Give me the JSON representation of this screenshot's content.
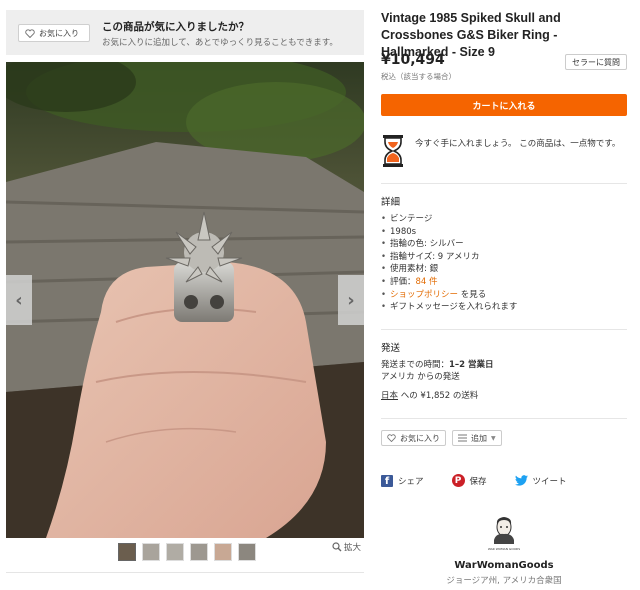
{
  "favorite_banner": {
    "button_label": "お気に入り",
    "heading": "この商品が気に入りましたか？",
    "subtext": "お気に入りに追加して、あとでゆっくり見ることもできます。"
  },
  "listing": {
    "title": "Vintage 1985 Spiked Skull and Crossbones G&S Biker Ring - Hallmarked - Size 9",
    "price": "¥10,494",
    "tax_note": "税込（該当する場合）",
    "ask_seller_label": "セラーに質問",
    "add_to_cart_label": "カートに入れる",
    "scarcity_text": "今すぐ手に入れましょう。 この商品は、一点物です。"
  },
  "details": {
    "title": "詳細",
    "items": [
      "ビンテージ",
      "1980s",
      "指輪の色: シルバー",
      "指輪サイズ: 9 アメリカ",
      "使用素材: 銀"
    ],
    "reviews_prefix": "評価：",
    "reviews_count": "84 件",
    "shop_policy_link": "ショップポリシー",
    "shop_policy_suffix": "を見る",
    "gift_message": "ギフトメッセージを入れられます"
  },
  "shipping": {
    "title": "発送",
    "time_label": "発送までの時間：",
    "time_value": "1–2 営業日",
    "origin": "アメリカ からの発送",
    "destination_link": "日本",
    "destination_text": "への ¥1,852 の送料"
  },
  "actions": {
    "favorite_label": "お気に入り",
    "add_label": "追加"
  },
  "share": {
    "facebook": "シェア",
    "pinterest": "保存",
    "twitter": "ツイート"
  },
  "seller": {
    "logo_text": "WAR WOMAN GOODS",
    "name": "WarWomanGoods",
    "location": "ジョージア州, アメリカ合衆国"
  },
  "gallery": {
    "zoom_label": "拡大",
    "thumbnail_count": 6,
    "active_thumbnail": 1
  },
  "colors": {
    "cart_button": "#f56400",
    "link_orange": "#e26a00",
    "facebook": "#3b5998",
    "pinterest": "#cb2027",
    "twitter": "#1da1f2"
  }
}
